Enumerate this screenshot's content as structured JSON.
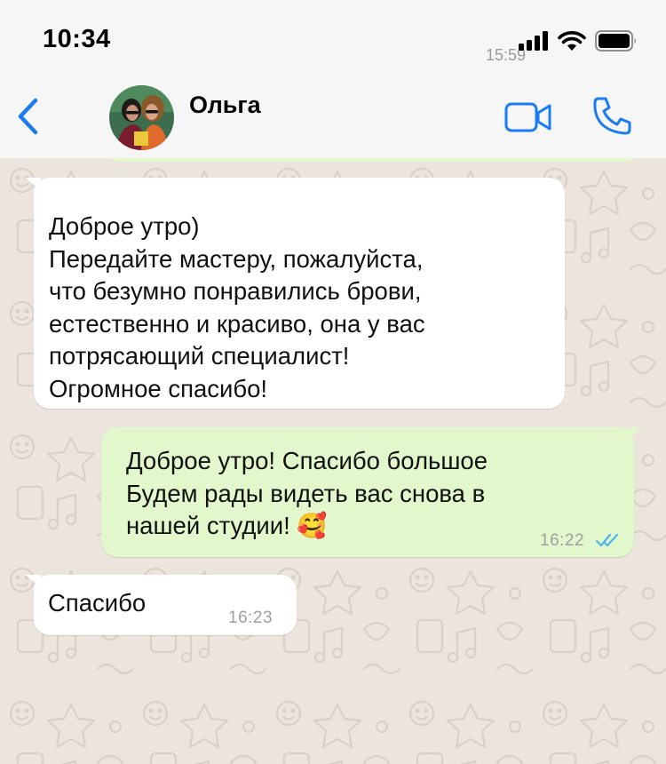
{
  "status_bar": {
    "time": "10:34",
    "background_time": "15:59",
    "icons": [
      "signal-bars-icon",
      "wifi-icon",
      "battery-icon"
    ]
  },
  "header": {
    "back_icon": "chevron-left-icon",
    "contact_name": "Ольга",
    "actions": [
      "video-call-icon",
      "phone-icon"
    ]
  },
  "colors": {
    "accent": "#1a7cf5",
    "bubble_incoming": "#ffffff",
    "bubble_outgoing": "#e2f7cb",
    "wallpaper": "#ece5dd",
    "read_ticks": "#4fb6ec"
  },
  "messages": [
    {
      "direction": "incoming",
      "text": "Доброе утро)\nПередайте мастеру, пожалуйста,\nчто безумно понравились брови,\nестественно и красиво, она у вас\nпотрясающий специалист!\nОгромное спасибо!",
      "time": ""
    },
    {
      "direction": "outgoing",
      "text": "Доброе утро! Спасибо большое\nБудем рады видеть вас снова в\nнашей студии! 🥰",
      "time": "16:22",
      "status": "read"
    },
    {
      "direction": "incoming",
      "text": "Спасибо",
      "time": "16:23"
    }
  ]
}
